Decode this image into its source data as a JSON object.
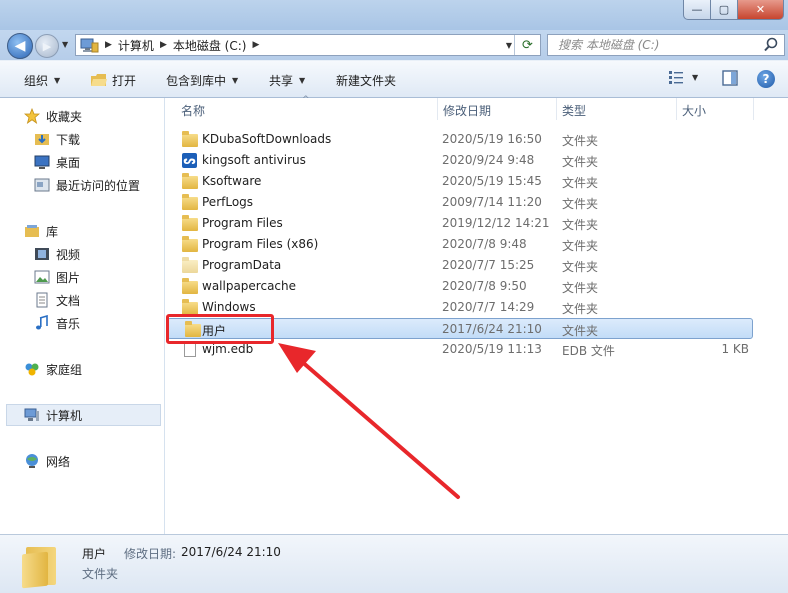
{
  "window": {
    "minimize_glyph": "—",
    "maximize_glyph": "▢",
    "close_glyph": "✕"
  },
  "address": {
    "crumbs": [
      "计算机",
      "本地磁盘 (C:)"
    ]
  },
  "search": {
    "placeholder": "搜索 本地磁盘 (C:)"
  },
  "toolbar": {
    "organize": "组织",
    "open": "打开",
    "include_in_library": "包含到库中",
    "share": "共享",
    "new_folder": "新建文件夹"
  },
  "nav": {
    "favorites": "收藏夹",
    "downloads": "下载",
    "desktop": "桌面",
    "recent": "最近访问的位置",
    "libraries": "库",
    "videos": "视频",
    "pictures": "图片",
    "documents": "文档",
    "music": "音乐",
    "homegroup": "家庭组",
    "computer": "计算机",
    "network": "网络"
  },
  "columns": {
    "name": "名称",
    "modified": "修改日期",
    "type": "类型",
    "size": "大小"
  },
  "files": [
    {
      "name": "KDubaSoftDownloads",
      "modified": "2020/5/19 16:50",
      "type": "文件夹",
      "size": "",
      "icon": "folder-icon"
    },
    {
      "name": "kingsoft antivirus",
      "modified": "2020/9/24 9:48",
      "type": "文件夹",
      "size": "",
      "icon": "app-icon"
    },
    {
      "name": "Ksoftware",
      "modified": "2020/5/19 15:45",
      "type": "文件夹",
      "size": "",
      "icon": "folder-icon"
    },
    {
      "name": "PerfLogs",
      "modified": "2009/7/14 11:20",
      "type": "文件夹",
      "size": "",
      "icon": "folder-icon"
    },
    {
      "name": "Program Files",
      "modified": "2019/12/12 14:21",
      "type": "文件夹",
      "size": "",
      "icon": "folder-icon"
    },
    {
      "name": "Program Files (x86)",
      "modified": "2020/7/8 9:48",
      "type": "文件夹",
      "size": "",
      "icon": "folder-icon"
    },
    {
      "name": "ProgramData",
      "modified": "2020/7/7 15:25",
      "type": "文件夹",
      "size": "",
      "icon": "folder-pale-icon"
    },
    {
      "name": "wallpapercache",
      "modified": "2020/7/8 9:50",
      "type": "文件夹",
      "size": "",
      "icon": "folder-icon"
    },
    {
      "name": "Windows",
      "modified": "2020/7/7 14:29",
      "type": "文件夹",
      "size": "",
      "icon": "folder-icon"
    },
    {
      "name": "用户",
      "modified": "2017/6/24 21:10",
      "type": "文件夹",
      "size": "",
      "icon": "folder-icon"
    },
    {
      "name": "wjm.edb",
      "modified": "2020/5/19 11:13",
      "type": "EDB 文件",
      "size": "1 KB",
      "icon": "file-icon"
    }
  ],
  "selected_index": 9,
  "details": {
    "name": "用户",
    "modified_label": "修改日期:",
    "modified_value": "2017/6/24 21:10",
    "type": "文件夹"
  },
  "colors": {
    "annotation": "#e8272b",
    "selection": "#c2dcf7"
  }
}
